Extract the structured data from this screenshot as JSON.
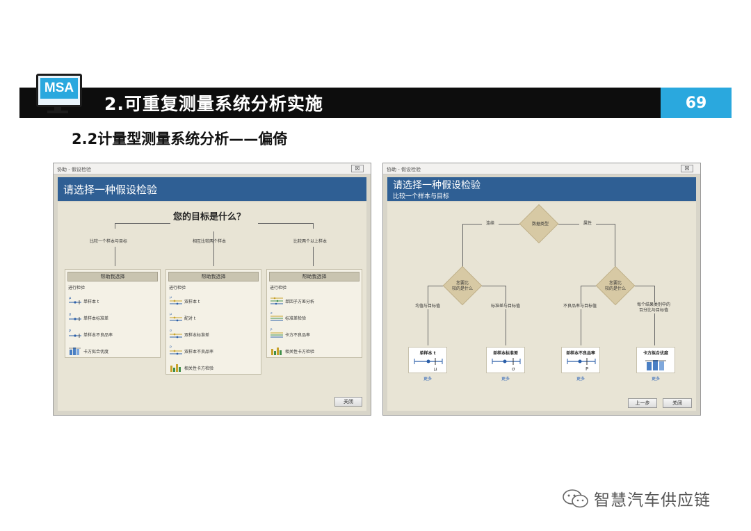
{
  "header": {
    "logo_text": "MSA",
    "title": "2.可重复测量系统分析实施",
    "page_number": "69"
  },
  "subtitle": "2.2计量型测量系统分析——偏倚",
  "dialog1": {
    "window_title": "协助 - 假设检验",
    "close_glyph": "☒",
    "banner_title": "请选择一种假设检验",
    "goal_title": "您的目标是什么？",
    "branches": [
      "比较一个样本与目标",
      "相互比较两个样本",
      "比较两个以上样本"
    ],
    "panels": [
      {
        "head": "帮助我选择",
        "sub": "进行检验",
        "items": [
          {
            "icon": "mu-interval-icon",
            "label": "单样本 t"
          },
          {
            "icon": "sigma-interval-icon",
            "label": "单样本标准差"
          },
          {
            "icon": "p-interval-icon",
            "label": "单样本不良品率"
          },
          {
            "icon": "bar-chart-icon",
            "label": "卡方拟合优度"
          }
        ]
      },
      {
        "head": "帮助我选择",
        "sub": "进行检验",
        "items": [
          {
            "icon": "mu-two-interval-icon",
            "label": "双样本 t"
          },
          {
            "icon": "mu-two-interval-icon",
            "label": "配对 t"
          },
          {
            "icon": "sigma-two-interval-icon",
            "label": "双样本标准差"
          },
          {
            "icon": "p-two-interval-icon",
            "label": "双样本不良品率"
          },
          {
            "icon": "bar-chart-green-icon",
            "label": "相关性卡方检验"
          }
        ]
      },
      {
        "head": "帮助我选择",
        "sub": "进行检验",
        "items": [
          {
            "icon": "multi-mean-icon",
            "label": "单因子方差分析"
          },
          {
            "icon": "multi-sigma-icon",
            "label": "标准差检验"
          },
          {
            "icon": "multi-p-icon",
            "label": "卡方不良品率"
          },
          {
            "icon": "bar-chart-green-icon",
            "label": "相关性卡方检验"
          }
        ]
      }
    ],
    "close_button": "关闭"
  },
  "dialog2": {
    "window_title": "协助 - 假设检验",
    "close_glyph": "☒",
    "banner_title": "请选择一种假设检验",
    "banner_subtitle": "比较一个样本与目标",
    "root_label": "数据类型",
    "left_edge": "连续",
    "right_edge": "属性",
    "decision_left": [
      "您要比",
      "较的是什么"
    ],
    "decision_right": [
      "您要比",
      "较的是什么"
    ],
    "leaf_labels": [
      [
        "均值与目标值"
      ],
      [
        "标准差与目标值"
      ],
      [
        "不良品率与目标值"
      ],
      [
        "每个结果类别中的",
        "百分比与目标值"
      ]
    ],
    "cards": [
      {
        "title": "单样本 t",
        "symbol": "μ",
        "icon": "mu-target-icon"
      },
      {
        "title": "单样本标准差",
        "symbol": "σ",
        "icon": "sigma-target-icon"
      },
      {
        "title": "单样本不良品率",
        "symbol": "P",
        "icon": "p-target-icon"
      },
      {
        "title": "卡方拟合优度",
        "symbol": "",
        "icon": "bar-chart-icon"
      }
    ],
    "more_link": "更多",
    "back_button": "上一步",
    "close_button": "关闭"
  },
  "watermark": {
    "icon": "wechat-icon",
    "text": "智慧汽车供应链"
  },
  "colors": {
    "accent_blue": "#2aa8de",
    "banner_blue": "#2f5f94",
    "header_black": "#0d0d0d",
    "dialog_bg": "#e8e4d5",
    "diamond_tan": "#d7c9a4"
  }
}
